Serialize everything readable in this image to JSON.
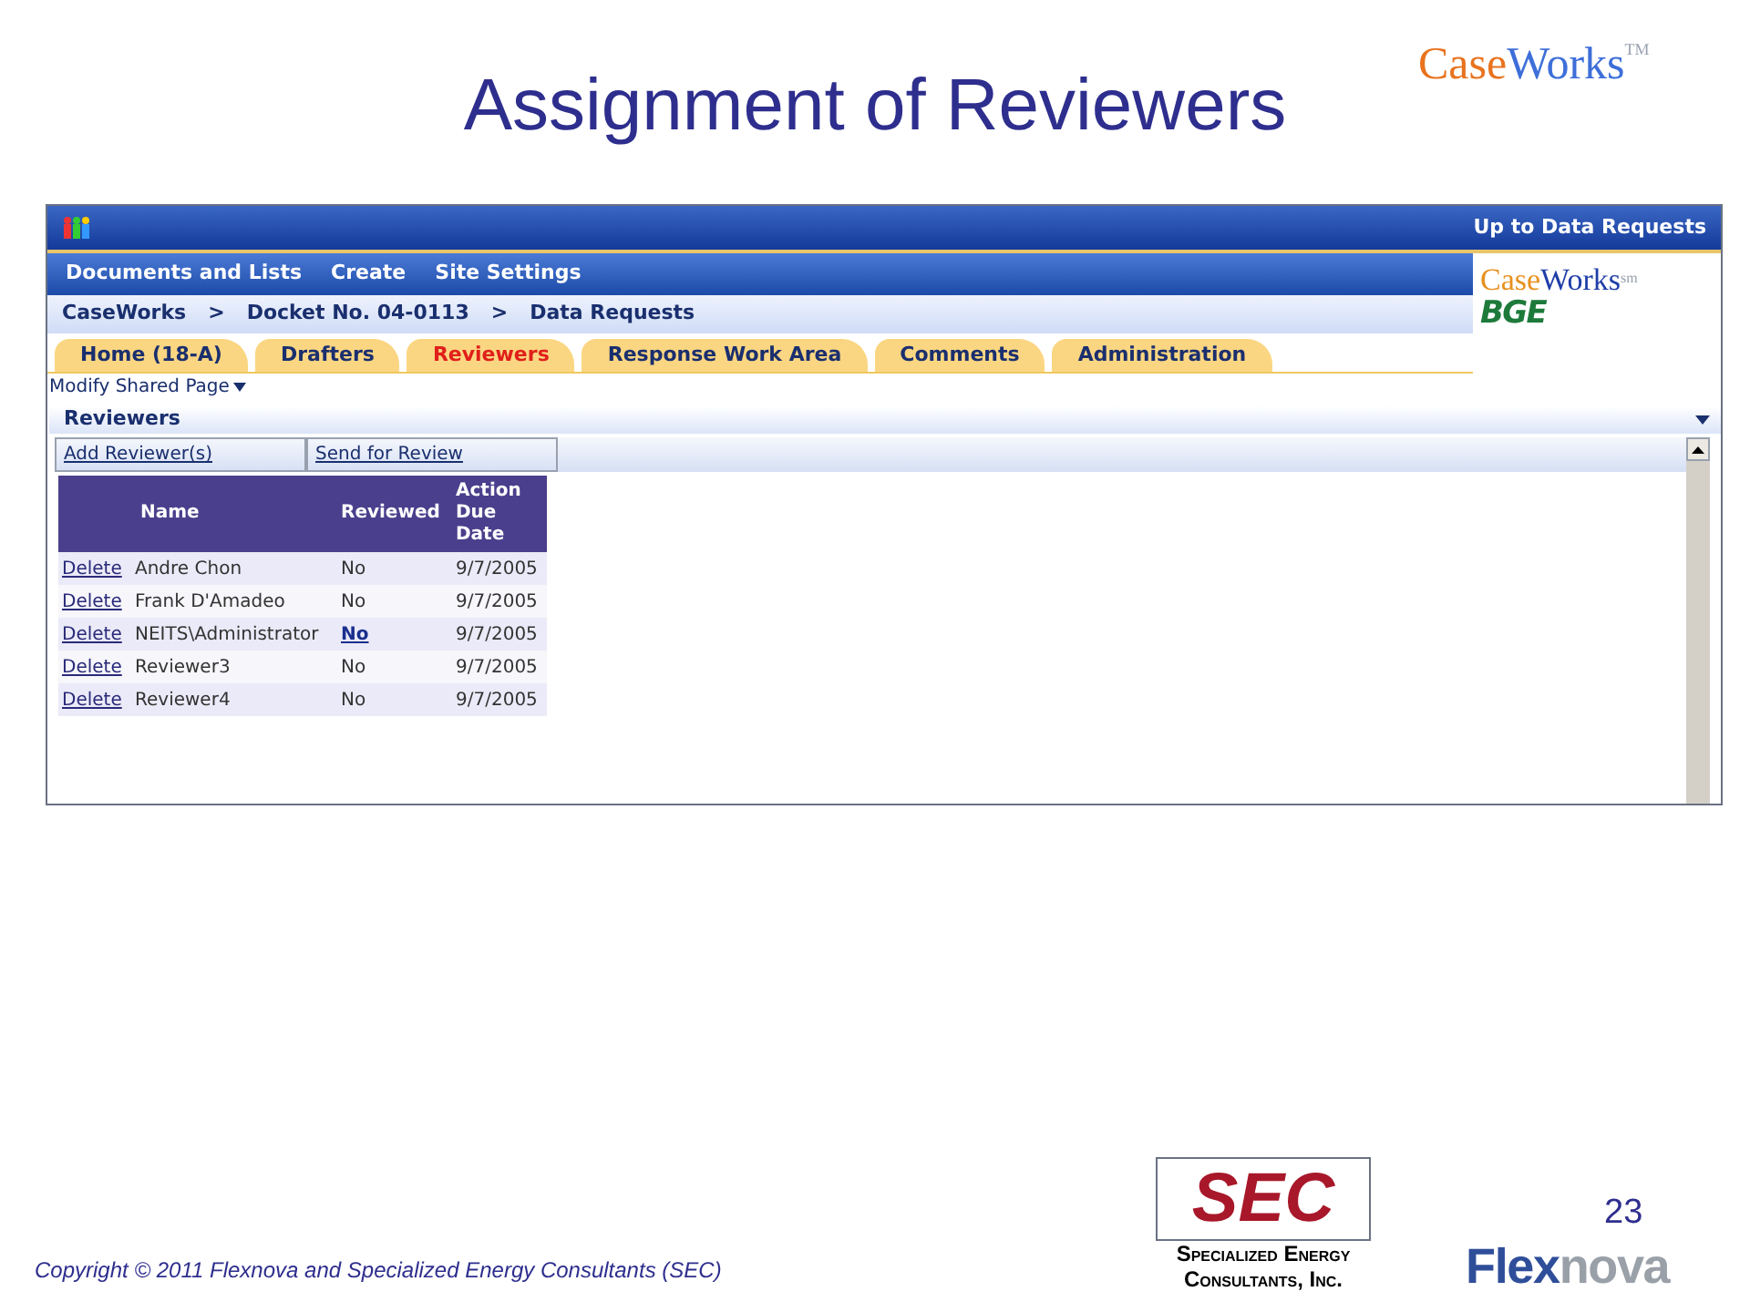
{
  "slide": {
    "title": "Assignment of Reviewers",
    "brand": {
      "first": "Case",
      "second": "Works",
      "mark": "TM"
    },
    "page_number": "23",
    "copyright": "Copyright © 2011 Flexnova and Specialized Energy Consultants (SEC)",
    "sec_logo": {
      "letters": "SEC",
      "lines": [
        "Specialized Energy",
        "Consultants, Inc."
      ]
    },
    "flexnova_logo": {
      "first": "Flex",
      "second": "nova"
    }
  },
  "app": {
    "top_link": "Up to Data Requests",
    "menu": [
      "Documents and Lists",
      "Create",
      "Site Settings"
    ],
    "breadcrumb": [
      {
        "label": "CaseWorks"
      },
      {
        "label": "Docket No. 04-0113"
      },
      {
        "label": "Data Requests"
      }
    ],
    "separator": ">",
    "logo": {
      "first": "Case",
      "second": "Works",
      "mark": "sm",
      "company": "BGE"
    },
    "tabs": [
      {
        "label": "Home (18-A)",
        "selected": false
      },
      {
        "label": "Drafters",
        "selected": false
      },
      {
        "label": "Reviewers",
        "selected": true
      },
      {
        "label": "Response Work Area",
        "selected": false
      },
      {
        "label": "Comments",
        "selected": false
      },
      {
        "label": "Administration",
        "selected": false
      }
    ],
    "modify_link": "Modify Shared Page",
    "section_title": "Reviewers",
    "toolbar": [
      "Add Reviewer(s)",
      "Send for Review"
    ],
    "table": {
      "columns": [
        "Name",
        "Reviewed",
        "Action Due Date"
      ],
      "rows": [
        {
          "action": "Delete",
          "name": "Andre Chon",
          "reviewed": "No",
          "reviewed_link": false,
          "due": "9/7/2005"
        },
        {
          "action": "Delete",
          "name": "Frank D'Amadeo",
          "reviewed": "No",
          "reviewed_link": false,
          "due": "9/7/2005"
        },
        {
          "action": "Delete",
          "name": "NEITS\\Administrator",
          "reviewed": "No",
          "reviewed_link": true,
          "due": "9/7/2005"
        },
        {
          "action": "Delete",
          "name": "Reviewer3",
          "reviewed": "No",
          "reviewed_link": false,
          "due": "9/7/2005"
        },
        {
          "action": "Delete",
          "name": "Reviewer4",
          "reviewed": "No",
          "reviewed_link": false,
          "due": "9/7/2005"
        }
      ]
    }
  }
}
